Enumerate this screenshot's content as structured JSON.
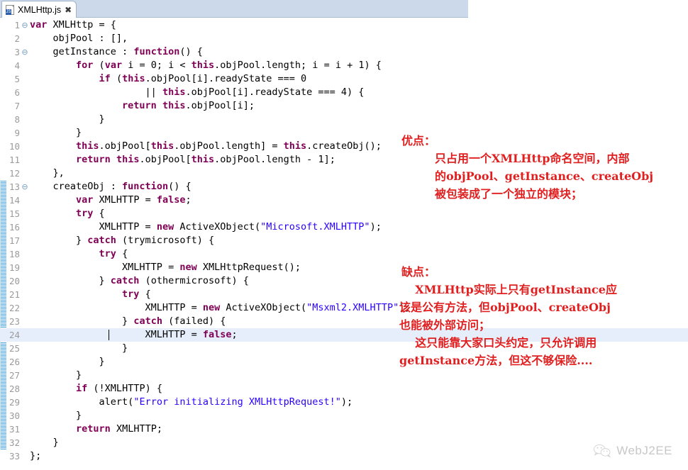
{
  "window": {
    "background_color": "#ffffff"
  },
  "tabbar": {
    "background_color": "#cbd9ea",
    "tab": {
      "label": "XMLHttp.js",
      "icon": "js-file-icon",
      "badge": "JS",
      "close_label": "✖",
      "active": true
    }
  },
  "editor": {
    "current_line": 24,
    "caret_line": 24,
    "change_bar_lines": [
      13,
      14,
      15,
      16,
      17,
      18,
      19,
      20,
      21,
      22,
      23,
      24,
      25,
      26,
      27,
      28,
      29,
      30,
      31,
      32
    ],
    "fold_lines": [
      1,
      3,
      13
    ],
    "syntax_colors": {
      "keyword": "#7f0055",
      "string": "#2a00ff",
      "plain": "#000000",
      "line_number": "#9a9a9a",
      "current_line_bg": "#e5eefa",
      "fold_marker": "#6f9ac4"
    },
    "lines": [
      {
        "n": 1,
        "fold": true,
        "tokens": [
          {
            "t": "kw",
            "v": "var"
          },
          {
            "t": "pln",
            "v": " XMLHttp = {"
          }
        ]
      },
      {
        "n": 2,
        "fold": false,
        "tokens": [
          {
            "t": "pln",
            "v": "    objPool : [],"
          }
        ]
      },
      {
        "n": 3,
        "fold": true,
        "tokens": [
          {
            "t": "pln",
            "v": "    getInstance : "
          },
          {
            "t": "kw",
            "v": "function"
          },
          {
            "t": "pln",
            "v": "() {"
          }
        ]
      },
      {
        "n": 4,
        "fold": false,
        "tokens": [
          {
            "t": "pln",
            "v": "        "
          },
          {
            "t": "kw",
            "v": "for"
          },
          {
            "t": "pln",
            "v": " ("
          },
          {
            "t": "kw",
            "v": "var"
          },
          {
            "t": "pln",
            "v": " i = 0; i < "
          },
          {
            "t": "ths",
            "v": "this"
          },
          {
            "t": "pln",
            "v": ".objPool.length; i = i + 1) {"
          }
        ]
      },
      {
        "n": 5,
        "fold": false,
        "tokens": [
          {
            "t": "pln",
            "v": "            "
          },
          {
            "t": "kw",
            "v": "if"
          },
          {
            "t": "pln",
            "v": " ("
          },
          {
            "t": "ths",
            "v": "this"
          },
          {
            "t": "pln",
            "v": ".objPool[i].readyState === 0"
          }
        ]
      },
      {
        "n": 6,
        "fold": false,
        "tokens": [
          {
            "t": "pln",
            "v": "                    || "
          },
          {
            "t": "ths",
            "v": "this"
          },
          {
            "t": "pln",
            "v": ".objPool[i].readyState === 4) {"
          }
        ]
      },
      {
        "n": 7,
        "fold": false,
        "tokens": [
          {
            "t": "pln",
            "v": "                "
          },
          {
            "t": "kw",
            "v": "return"
          },
          {
            "t": "pln",
            "v": " "
          },
          {
            "t": "ths",
            "v": "this"
          },
          {
            "t": "pln",
            "v": ".objPool[i];"
          }
        ]
      },
      {
        "n": 8,
        "fold": false,
        "tokens": [
          {
            "t": "pln",
            "v": "            }"
          }
        ]
      },
      {
        "n": 9,
        "fold": false,
        "tokens": [
          {
            "t": "pln",
            "v": "        }"
          }
        ]
      },
      {
        "n": 10,
        "fold": false,
        "tokens": [
          {
            "t": "pln",
            "v": "        "
          },
          {
            "t": "ths",
            "v": "this"
          },
          {
            "t": "pln",
            "v": ".objPool["
          },
          {
            "t": "ths",
            "v": "this"
          },
          {
            "t": "pln",
            "v": ".objPool.length] = "
          },
          {
            "t": "ths",
            "v": "this"
          },
          {
            "t": "pln",
            "v": ".createObj();"
          }
        ]
      },
      {
        "n": 11,
        "fold": false,
        "tokens": [
          {
            "t": "pln",
            "v": "        "
          },
          {
            "t": "kw",
            "v": "return"
          },
          {
            "t": "pln",
            "v": " "
          },
          {
            "t": "ths",
            "v": "this"
          },
          {
            "t": "pln",
            "v": ".objPool["
          },
          {
            "t": "ths",
            "v": "this"
          },
          {
            "t": "pln",
            "v": ".objPool.length - 1];"
          }
        ]
      },
      {
        "n": 12,
        "fold": false,
        "tokens": [
          {
            "t": "pln",
            "v": "    },"
          }
        ]
      },
      {
        "n": 13,
        "fold": true,
        "tokens": [
          {
            "t": "pln",
            "v": "    createObj : "
          },
          {
            "t": "kw",
            "v": "function"
          },
          {
            "t": "pln",
            "v": "() {"
          }
        ]
      },
      {
        "n": 14,
        "fold": false,
        "tokens": [
          {
            "t": "pln",
            "v": "        "
          },
          {
            "t": "kw",
            "v": "var"
          },
          {
            "t": "pln",
            "v": " XMLHTTP = "
          },
          {
            "t": "kw",
            "v": "false"
          },
          {
            "t": "pln",
            "v": ";"
          }
        ]
      },
      {
        "n": 15,
        "fold": false,
        "tokens": [
          {
            "t": "pln",
            "v": "        "
          },
          {
            "t": "kw",
            "v": "try"
          },
          {
            "t": "pln",
            "v": " {"
          }
        ]
      },
      {
        "n": 16,
        "fold": false,
        "tokens": [
          {
            "t": "pln",
            "v": "            XMLHTTP = "
          },
          {
            "t": "kw",
            "v": "new"
          },
          {
            "t": "pln",
            "v": " ActiveXObject("
          },
          {
            "t": "str",
            "v": "\"Microsoft.XMLHTTP\""
          },
          {
            "t": "pln",
            "v": ");"
          }
        ]
      },
      {
        "n": 17,
        "fold": false,
        "tokens": [
          {
            "t": "pln",
            "v": "        } "
          },
          {
            "t": "kw",
            "v": "catch"
          },
          {
            "t": "pln",
            "v": " (trymicrosoft) {"
          }
        ]
      },
      {
        "n": 18,
        "fold": false,
        "tokens": [
          {
            "t": "pln",
            "v": "            "
          },
          {
            "t": "kw",
            "v": "try"
          },
          {
            "t": "pln",
            "v": " {"
          }
        ]
      },
      {
        "n": 19,
        "fold": false,
        "tokens": [
          {
            "t": "pln",
            "v": "                XMLHTTP = "
          },
          {
            "t": "kw",
            "v": "new"
          },
          {
            "t": "pln",
            "v": " XMLHttpRequest();"
          }
        ]
      },
      {
        "n": 20,
        "fold": false,
        "tokens": [
          {
            "t": "pln",
            "v": "            } "
          },
          {
            "t": "kw",
            "v": "catch"
          },
          {
            "t": "pln",
            "v": " (othermicrosoft) {"
          }
        ]
      },
      {
        "n": 21,
        "fold": false,
        "tokens": [
          {
            "t": "pln",
            "v": "                "
          },
          {
            "t": "kw",
            "v": "try"
          },
          {
            "t": "pln",
            "v": " {"
          }
        ]
      },
      {
        "n": 22,
        "fold": false,
        "tokens": [
          {
            "t": "pln",
            "v": "                    XMLHTTP = "
          },
          {
            "t": "kw",
            "v": "new"
          },
          {
            "t": "pln",
            "v": " ActiveXObject("
          },
          {
            "t": "str",
            "v": "\"Msxml2.XMLHTTP\""
          },
          {
            "t": "pln",
            "v": ");"
          }
        ]
      },
      {
        "n": 23,
        "fold": false,
        "tokens": [
          {
            "t": "pln",
            "v": "                } "
          },
          {
            "t": "kw",
            "v": "catch"
          },
          {
            "t": "pln",
            "v": " (failed) {"
          }
        ]
      },
      {
        "n": 24,
        "fold": false,
        "tokens": [
          {
            "t": "pln",
            "v": "                    XMLHTTP = "
          },
          {
            "t": "kw",
            "v": "false"
          },
          {
            "t": "pln",
            "v": ";"
          }
        ]
      },
      {
        "n": 25,
        "fold": false,
        "tokens": [
          {
            "t": "pln",
            "v": "                }"
          }
        ]
      },
      {
        "n": 26,
        "fold": false,
        "tokens": [
          {
            "t": "pln",
            "v": "            }"
          }
        ]
      },
      {
        "n": 27,
        "fold": false,
        "tokens": [
          {
            "t": "pln",
            "v": "        }"
          }
        ]
      },
      {
        "n": 28,
        "fold": false,
        "tokens": [
          {
            "t": "pln",
            "v": "        "
          },
          {
            "t": "kw",
            "v": "if"
          },
          {
            "t": "pln",
            "v": " (!XMLHTTP) {"
          }
        ]
      },
      {
        "n": 29,
        "fold": false,
        "tokens": [
          {
            "t": "pln",
            "v": "            alert("
          },
          {
            "t": "str",
            "v": "\"Error initializing XMLHttpRequest!\""
          },
          {
            "t": "pln",
            "v": ");"
          }
        ]
      },
      {
        "n": 30,
        "fold": false,
        "tokens": [
          {
            "t": "pln",
            "v": "        }"
          }
        ]
      },
      {
        "n": 31,
        "fold": false,
        "tokens": [
          {
            "t": "pln",
            "v": "        "
          },
          {
            "t": "kw",
            "v": "return"
          },
          {
            "t": "pln",
            "v": " XMLHTTP;"
          }
        ]
      },
      {
        "n": 32,
        "fold": false,
        "tokens": [
          {
            "t": "pln",
            "v": "    }"
          }
        ]
      },
      {
        "n": 33,
        "fold": false,
        "tokens": [
          {
            "t": "pln",
            "v": "};"
          }
        ]
      }
    ]
  },
  "annotations": {
    "color": "#e02020",
    "pros": {
      "heading": "优点：",
      "body_lines": [
        "只占用一个XMLHttp命名空间，内部",
        "的objPool、getInstance、createObj",
        "被包装成了一个独立的模块；"
      ]
    },
    "cons": {
      "heading": "缺点：",
      "body_lines": [
        "    XMLHttp实际上只有getInstance应",
        "该是公有方法，但objPool、createObj",
        "也能被外部访问；",
        "    这只能靠大家口头约定，只允许调用",
        "getInstance方法，但这不够保险...."
      ]
    }
  },
  "watermark": {
    "text": "WebJ2EE",
    "icon": "wechat-icon",
    "color": "#9a9a9a"
  }
}
